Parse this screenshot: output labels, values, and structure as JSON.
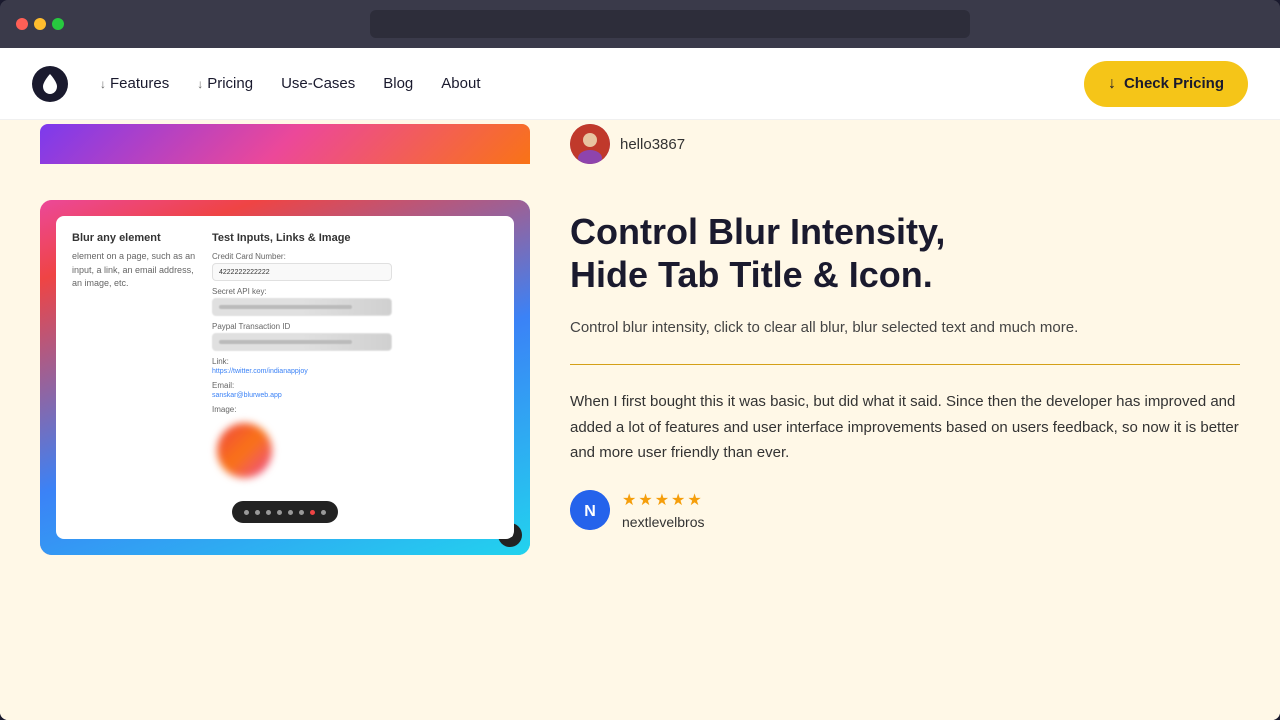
{
  "browser": {
    "traffic_lights": [
      "red",
      "yellow",
      "green"
    ],
    "address_bar_placeholder": ""
  },
  "nav": {
    "logo_icon": "droplet",
    "links": [
      {
        "label": "Features",
        "has_arrow": true
      },
      {
        "label": "Pricing",
        "has_arrow": true
      },
      {
        "label": "Use-Cases",
        "has_arrow": false
      },
      {
        "label": "Blog",
        "has_arrow": false
      },
      {
        "label": "About",
        "has_arrow": false
      }
    ],
    "cta_button": "Check Pricing"
  },
  "top_section": {
    "username": "hello3867"
  },
  "feature_section": {
    "app_preview": {
      "blur_panel": {
        "title": "Blur any element",
        "description": "element on a page, such as an input, a link, an email address, an image, etc."
      },
      "test_inputs_panel": {
        "title": "Test Inputs, Links & Image",
        "fields": [
          {
            "label": "Credit Card Number:",
            "value": "4222222222222",
            "blurred": false
          },
          {
            "label": "Secret API key:",
            "value": "",
            "blurred": true
          },
          {
            "label": "Paypal Transaction ID",
            "value": "",
            "blurred": true
          },
          {
            "label": "Link:",
            "value": "https://twitter.com/indianappjoy",
            "blurred": false
          },
          {
            "label": "Email:",
            "value": "sanskar@blurweb.app",
            "blurred": false
          },
          {
            "label": "Image:",
            "value": "",
            "blurred": false
          }
        ]
      }
    },
    "title_line1": "Control Blur Intensity,",
    "title_line2": "Hide Tab Title & Icon.",
    "description": "Control blur intensity, click to clear all blur, blur selected text and much more.",
    "testimonial": "When I first bought this it was basic, but did what it said. Since then the developer has improved and added a lot of features and user interface improvements based on users feedback, so now it is better and more user friendly than ever.",
    "reviewer": {
      "name": "nextlevelbros",
      "stars": 5,
      "avatar_initials": "N"
    }
  }
}
